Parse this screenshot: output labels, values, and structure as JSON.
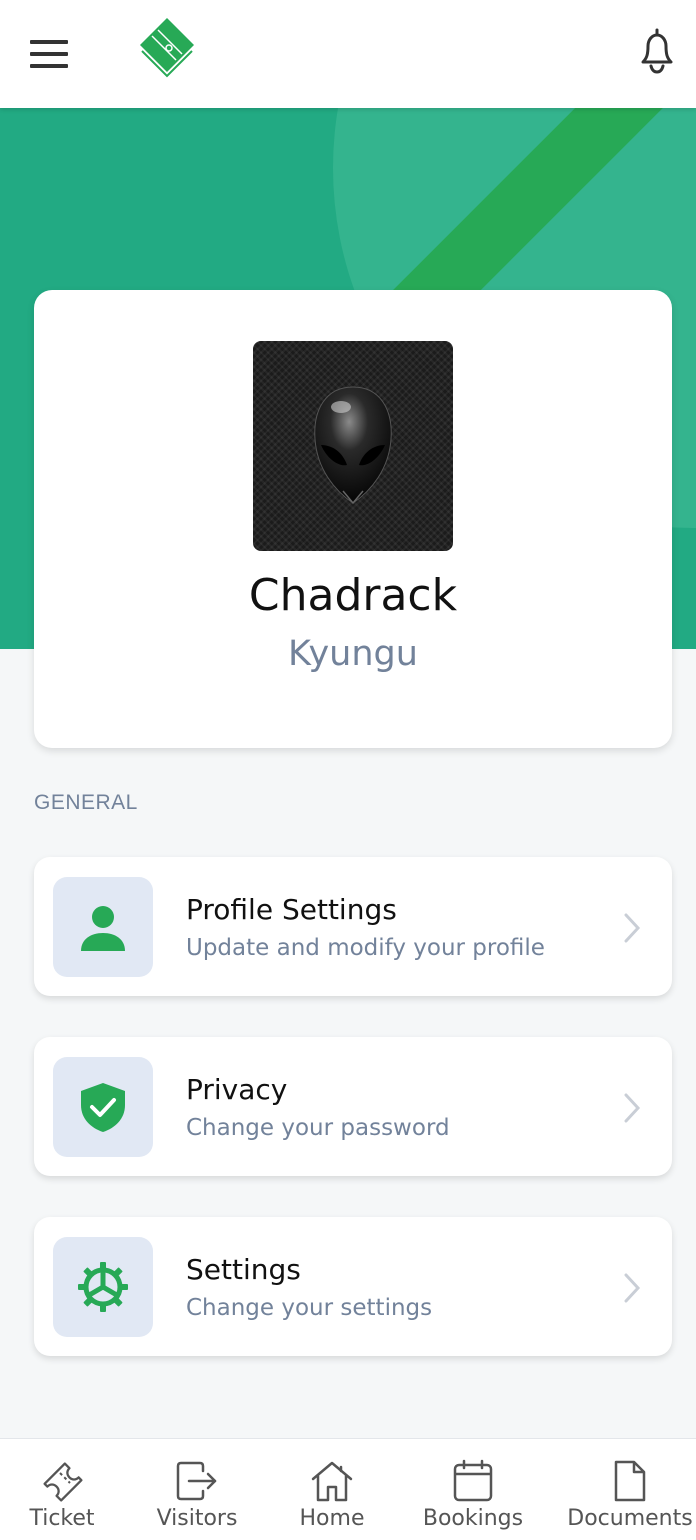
{
  "header": {
    "menu_icon": "hamburger-menu-icon",
    "logo_icon": "field-diamond-logo",
    "bell_icon": "bell-icon",
    "brand_color": "#22aa83"
  },
  "profile": {
    "first_name": "Chadrack",
    "last_name": "Kyungu",
    "avatar_icon": "alien-head-avatar"
  },
  "section": {
    "label": "GENERAL"
  },
  "menu": [
    {
      "title": "Profile Settings",
      "subtitle": "Update and modify your profile",
      "icon": "person-icon"
    },
    {
      "title": "Privacy",
      "subtitle": "Change your password",
      "icon": "shield-check-icon"
    },
    {
      "title": "Settings",
      "subtitle": "Change your settings",
      "icon": "gear-icon"
    }
  ],
  "bottom_nav": [
    {
      "label": "Ticket",
      "icon": "ticket-icon"
    },
    {
      "label": "Visitors",
      "icon": "exit-arrow-icon"
    },
    {
      "label": "Home",
      "icon": "home-icon"
    },
    {
      "label": "Bookings",
      "icon": "calendar-icon"
    },
    {
      "label": "Documents",
      "icon": "document-icon"
    }
  ]
}
